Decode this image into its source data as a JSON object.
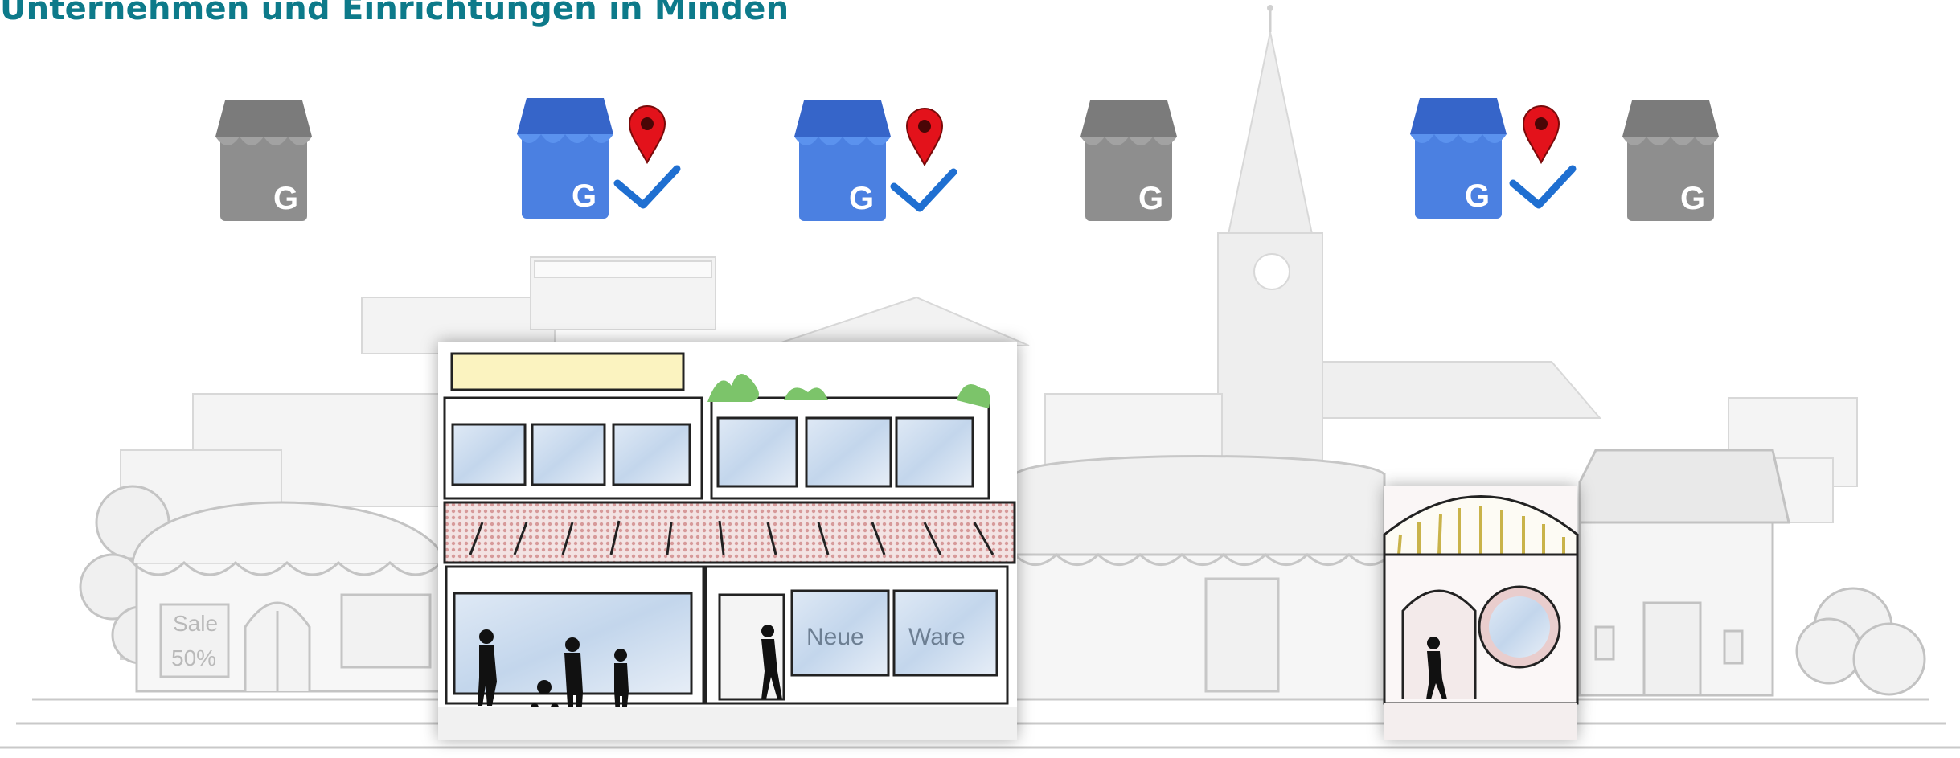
{
  "page": {
    "title": "Unternehmen und Einrichtungen in Minden"
  },
  "illustration": {
    "shop_sale_sign": [
      "Sale",
      "50%"
    ],
    "shop_window_text": [
      "Neue",
      "Ware"
    ]
  },
  "business_profiles": [
    {
      "icon": "google-my-business-icon",
      "state": "unclaimed",
      "color": "#8d8d8d"
    },
    {
      "icon": "google-my-business-icon",
      "state": "verified",
      "color": "#4a7fe0"
    },
    {
      "icon": "google-my-business-icon",
      "state": "verified",
      "color": "#4a7fe0"
    },
    {
      "icon": "google-my-business-icon",
      "state": "unclaimed",
      "color": "#8d8d8d"
    },
    {
      "icon": "google-my-business-icon",
      "state": "verified",
      "color": "#4a7fe0"
    },
    {
      "icon": "google-my-business-icon",
      "state": "unclaimed",
      "color": "#8d8d8d"
    }
  ],
  "colors": {
    "title": "#0d7a8a",
    "pin": "#e3121b",
    "check": "#1f6fd1",
    "sketch_gray": "#cfcfcf"
  }
}
